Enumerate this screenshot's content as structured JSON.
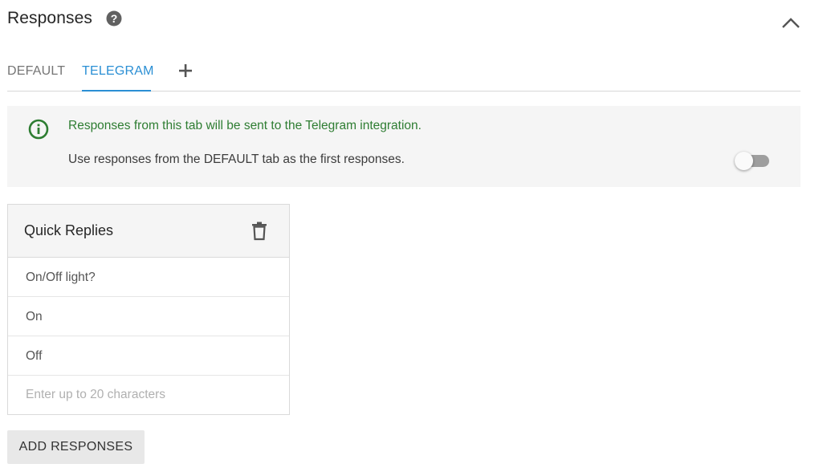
{
  "header": {
    "title": "Responses",
    "help_icon": "help-circle-icon",
    "collapse_icon": "chevron-up-icon"
  },
  "tabs": [
    {
      "label": "DEFAULT",
      "active": false
    },
    {
      "label": "TELEGRAM",
      "active": true
    }
  ],
  "add_tab_icon": "plus-icon",
  "info": {
    "icon": "info-circle-icon",
    "message": "Responses from this tab will be sent to the Telegram integration.",
    "option_label": "Use responses from the DEFAULT tab as the first responses.",
    "toggle_on": false
  },
  "quick_replies": {
    "title": "Quick Replies",
    "delete_icon": "trash-icon",
    "items": [
      "On/Off light?",
      "On",
      "Off"
    ],
    "input_placeholder": "Enter up to 20 characters"
  },
  "add_responses_label": "ADD RESPONSES",
  "colors": {
    "accent": "#2b8fd4",
    "info_green": "#2e7d32",
    "panel_bg": "#f5f5f5"
  }
}
